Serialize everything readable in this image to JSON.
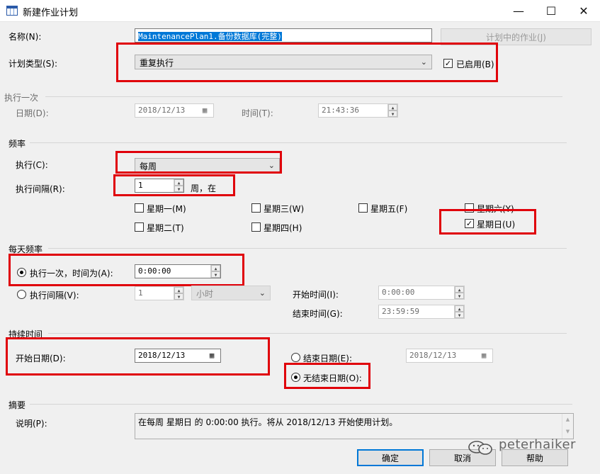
{
  "window": {
    "title": "新建作业计划",
    "minimize": "—",
    "maximize": "☐",
    "close": "✕"
  },
  "name": {
    "label": "名称(N):",
    "value": "MaintenancePlan1.备份数据库(完整)",
    "jobs_button": "计划中的作业(J)"
  },
  "schedule_type": {
    "label": "计划类型(S):",
    "value": "重复执行",
    "enabled_label": "已启用(B)",
    "enabled": true
  },
  "one_time": {
    "group": "执行一次",
    "date_label": "日期(D):",
    "date_value": "2018/12/13",
    "time_label": "时间(T):",
    "time_value": "21:43:36"
  },
  "frequency": {
    "group": "频率",
    "occurs_label": "执行(C):",
    "occurs_value": "每周",
    "recurs_label": "执行间隔(R):",
    "recurs_value": "1",
    "recurs_unit": "周，在",
    "days": [
      {
        "label": "星期一(M)",
        "checked": false
      },
      {
        "label": "星期三(W)",
        "checked": false
      },
      {
        "label": "星期五(F)",
        "checked": false
      },
      {
        "label": "星期六(Y)",
        "checked": false
      },
      {
        "label": "星期二(T)",
        "checked": false
      },
      {
        "label": "星期四(H)",
        "checked": false
      },
      {
        "label": "星期日(U)",
        "checked": true
      }
    ]
  },
  "daily": {
    "group": "每天频率",
    "once_label": "执行一次，时间为(A):",
    "once_value": "0:00:00",
    "every_label": "执行间隔(V):",
    "every_value": "1",
    "every_unit": "小时",
    "start_label": "开始时间(I):",
    "start_value": "0:00:00",
    "end_label": "结束时间(G):",
    "end_value": "23:59:59"
  },
  "duration": {
    "group": "持续时间",
    "start_label": "开始日期(D):",
    "start_value": "2018/12/13",
    "end_label": "结束日期(E):",
    "end_value": "2018/12/13",
    "noend_label": "无结束日期(O):"
  },
  "summary": {
    "group": "摘要",
    "desc_label": "说明(P):",
    "desc_value": "在每周 星期日 的 0:00:00 执行。将从 2018/12/13 开始使用计划。"
  },
  "buttons": {
    "ok": "确定",
    "cancel": "取消",
    "help": "帮助"
  },
  "watermark": "peterhaiker",
  "icons": {
    "checkmark": "✓",
    "chevron": "⌄",
    "spin_up": "▲",
    "spin_down": "▼",
    "calendar": "▦",
    "dropdown": "▾"
  }
}
